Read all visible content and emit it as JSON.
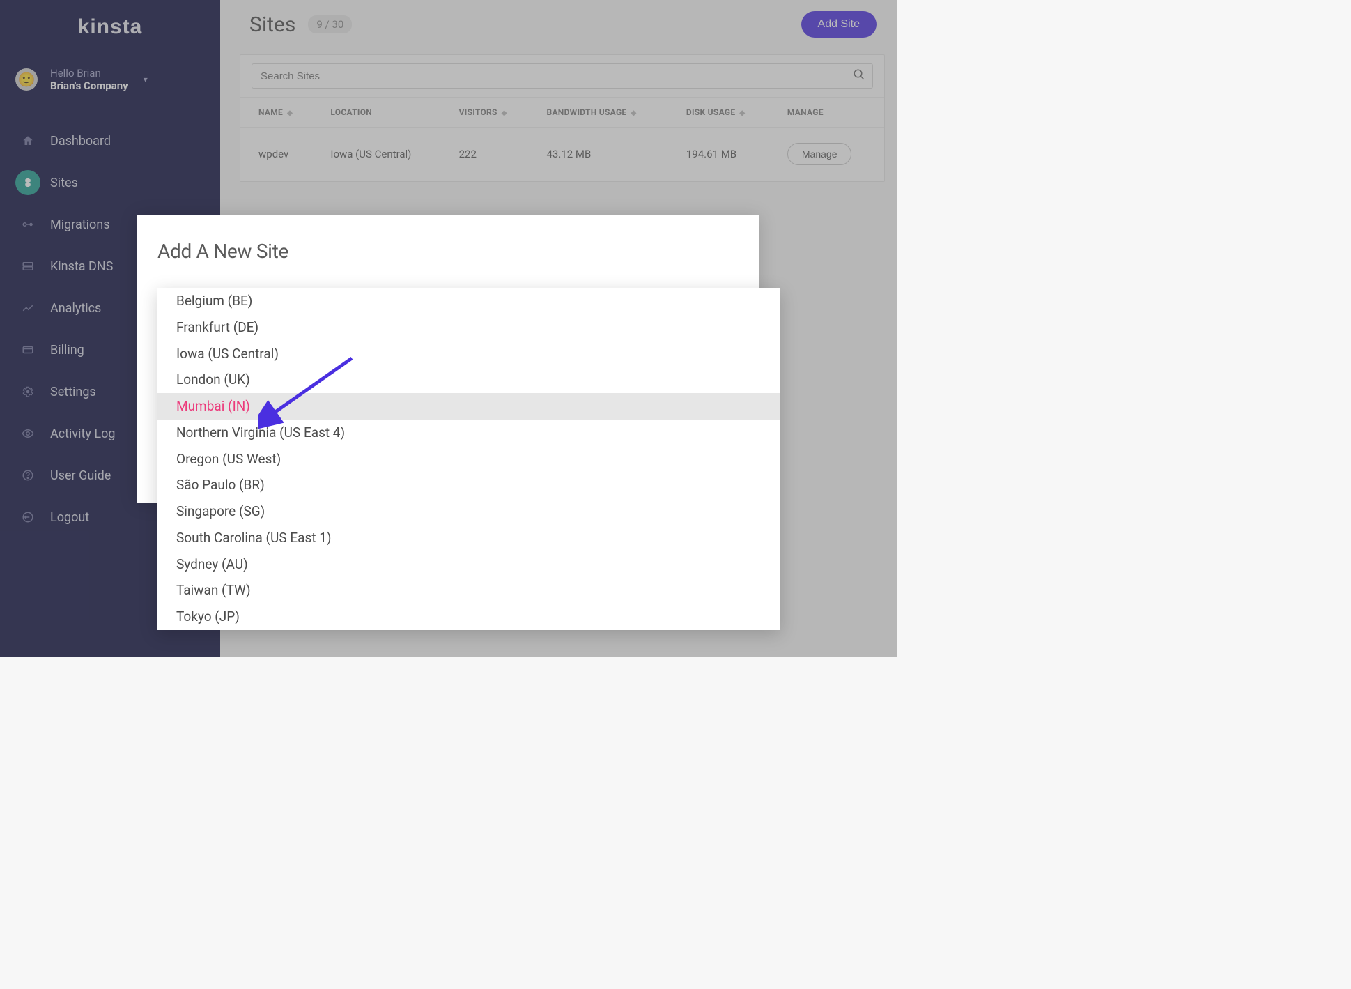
{
  "brand": "KINSTA",
  "user": {
    "greeting": "Hello Brian",
    "company": "Brian's Company"
  },
  "nav": [
    {
      "id": "dashboard",
      "label": "Dashboard",
      "icon": "home"
    },
    {
      "id": "sites",
      "label": "Sites",
      "icon": "sites",
      "active": true
    },
    {
      "id": "migrations",
      "label": "Migrations",
      "icon": "migrations"
    },
    {
      "id": "dns",
      "label": "Kinsta DNS",
      "icon": "dns"
    },
    {
      "id": "analytics",
      "label": "Analytics",
      "icon": "analytics"
    },
    {
      "id": "billing",
      "label": "Billing",
      "icon": "billing"
    },
    {
      "id": "settings",
      "label": "Settings",
      "icon": "settings"
    },
    {
      "id": "activity",
      "label": "Activity Log",
      "icon": "activity"
    },
    {
      "id": "guide",
      "label": "User Guide",
      "icon": "guide"
    },
    {
      "id": "logout",
      "label": "Logout",
      "icon": "logout"
    }
  ],
  "page": {
    "title": "Sites",
    "count": "9 / 30",
    "addButton": "Add Site",
    "searchPlaceholder": "Search Sites"
  },
  "table": {
    "headers": {
      "name": "NAME",
      "location": "LOCATION",
      "visitors": "VISITORS",
      "bandwidth": "BANDWIDTH USAGE",
      "disk": "DISK USAGE",
      "manage": "MANAGE"
    },
    "rows": [
      {
        "name": "wpdev",
        "location": "Iowa (US Central)",
        "visitors": "222",
        "bandwidth": "43.12 MB",
        "disk": "194.61 MB",
        "manage": "Manage"
      }
    ]
  },
  "modal": {
    "title": "Add A New Site",
    "locations": [
      "Belgium (BE)",
      "Frankfurt (DE)",
      "Iowa (US Central)",
      "London (UK)",
      "Mumbai (IN)",
      "Northern Virginia (US East 4)",
      "Oregon (US West)",
      "São Paulo (BR)",
      "Singapore (SG)",
      "South Carolina (US East 1)",
      "Sydney (AU)",
      "Taiwan (TW)",
      "Tokyo (JP)"
    ],
    "highlightedIndex": 4
  },
  "colors": {
    "sidebar": "#0b0d3f",
    "accent": "#4a2fe0",
    "activeNav": "#1a9b8f",
    "highlightText": "#ec3a7b"
  }
}
